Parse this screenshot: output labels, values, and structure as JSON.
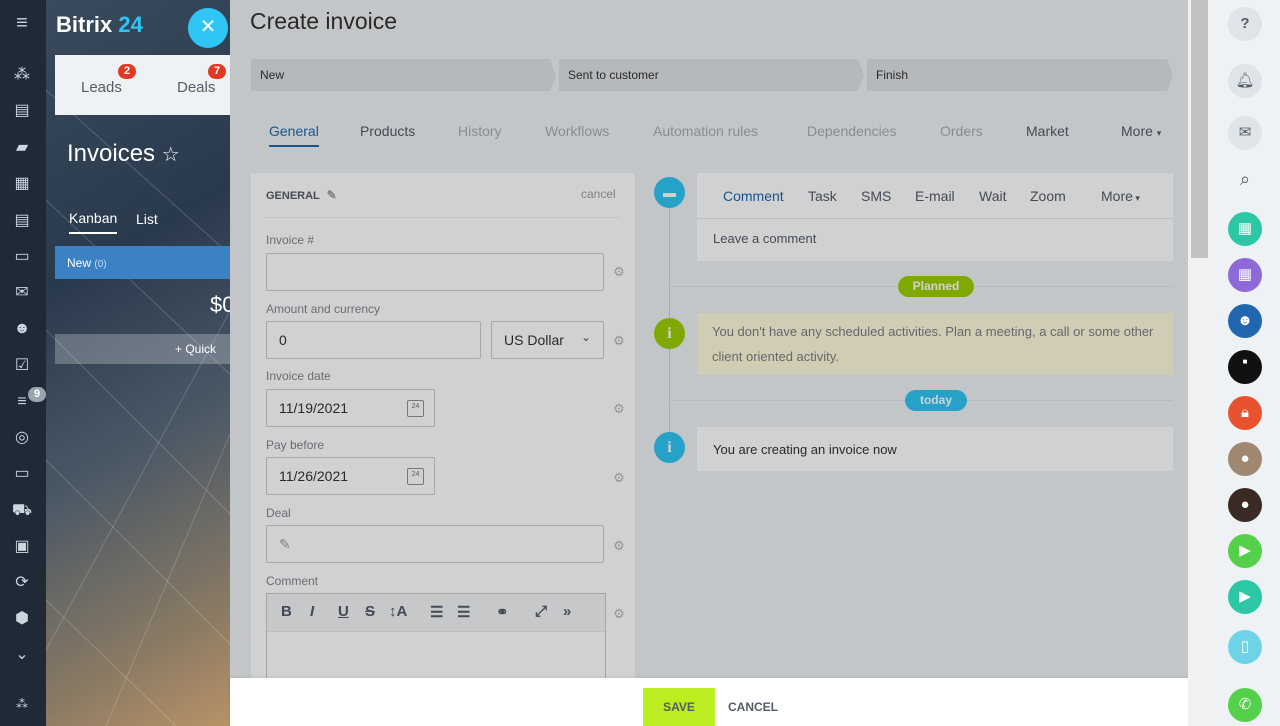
{
  "app": {
    "logo_main": "Bitrix",
    "logo_accent": "24"
  },
  "leftbar": {
    "counter": "9"
  },
  "background_page": {
    "funnel": [
      {
        "label": "Leads",
        "badge": "2"
      },
      {
        "label": "Deals",
        "badge": "7"
      }
    ],
    "title": "Invoices",
    "views": [
      "Kanban",
      "List"
    ],
    "column": {
      "name": "New",
      "count": "(0)"
    },
    "amount_fragment": "$0",
    "quick_label": "+ Quick"
  },
  "slider": {
    "title": "Create invoice",
    "stages": [
      "New",
      "Sent to customer",
      "Finish"
    ],
    "tabs": [
      {
        "label": "General",
        "state": "active"
      },
      {
        "label": "Products",
        "state": "normal"
      },
      {
        "label": "History",
        "state": "dim"
      },
      {
        "label": "Workflows",
        "state": "dim"
      },
      {
        "label": "Automation rules",
        "state": "dim"
      },
      {
        "label": "Dependencies",
        "state": "dim"
      },
      {
        "label": "Orders",
        "state": "dim"
      },
      {
        "label": "Market",
        "state": "normal"
      },
      {
        "label": "More",
        "state": "normal"
      }
    ]
  },
  "form": {
    "section_title": "GENERAL",
    "cancel_label": "cancel",
    "invoice_label": "Invoice #",
    "invoice_value": "",
    "amount_label": "Amount and currency",
    "amount_value": "0",
    "currency_value": "US Dollar",
    "invoice_date_label": "Invoice date",
    "invoice_date_value": "11/19/2021",
    "pay_before_label": "Pay before",
    "pay_before_value": "11/26/2021",
    "deal_label": "Deal",
    "comment_label": "Comment",
    "toolbar": [
      "B",
      "I",
      "U",
      "S",
      "↕A",
      "☰",
      "☰",
      "⚭",
      "⤢",
      "»"
    ]
  },
  "timeline": {
    "comment_tabs": [
      "Comment",
      "Task",
      "SMS",
      "E-mail",
      "Wait",
      "Zoom",
      "More"
    ],
    "comment_placeholder": "Leave a comment",
    "planned_pill": "Planned",
    "planned_text": "You don't have any scheduled activities. Plan a meeting, a call or some other client oriented activity.",
    "today_pill": "today",
    "creating_text": "You are creating an invoice now"
  },
  "footer": {
    "save_label": "SAVE",
    "cancel_label": "CANCEL"
  },
  "colors": {
    "accent": "#2fc6f6",
    "save": "#bbed21",
    "active_tab": "#2067b0",
    "planned": "#9dcf00",
    "today": "#2fc6f6"
  }
}
